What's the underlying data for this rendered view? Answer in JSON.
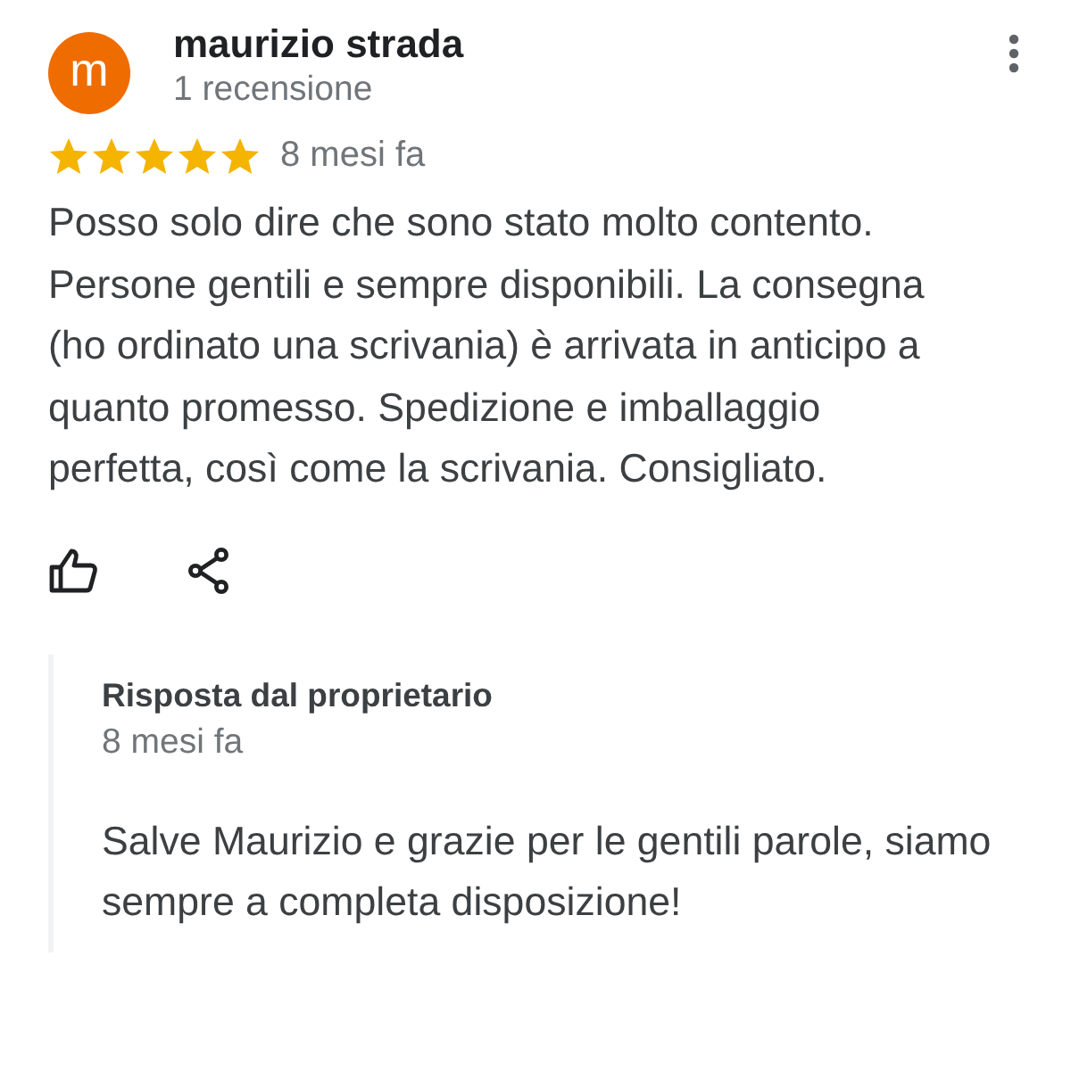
{
  "review": {
    "avatar_letter": "m",
    "author": "maurizio strada",
    "author_meta": "1 recensione",
    "stars": 5,
    "time": "8 mesi fa",
    "text": "Posso solo dire che sono stato molto contento. Persone gentili e sempre disponibili. La consegna (ho ordinato una scrivania) è arrivata in anticipo a quanto promesso. Spedizione e imballaggio perfetta, così come la scrivania. Consigliato."
  },
  "owner_reply": {
    "title": "Risposta dal proprietario",
    "time": "8 mesi fa",
    "text": "Salve Maurizio e grazie per le gentili parole, siamo sempre a completa disposizione!"
  }
}
